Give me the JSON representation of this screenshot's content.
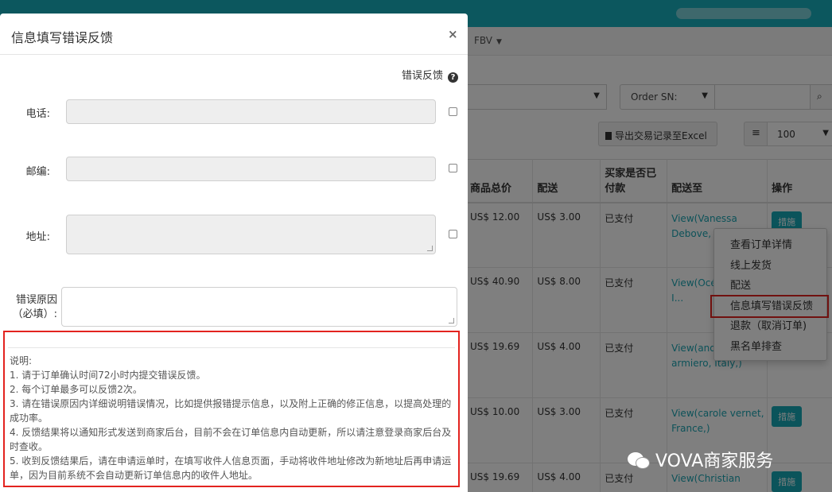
{
  "background": {
    "nav_item": "FBV",
    "order_sn_label": "Order SN:",
    "export_button": "导出交易记录至Excel",
    "page_size": "100",
    "table": {
      "headers": [
        "商品总价",
        "配送",
        "买家是否已付款",
        "配送至",
        "操作"
      ],
      "rows": [
        {
          "total": "US$ 12.00",
          "shipping": "US$ 3.00",
          "paid": "已支付",
          "ship_to": "View(Vanessa Debove, F...",
          "action": "措施"
        },
        {
          "total": "US$ 40.90",
          "shipping": "US$ 8.00",
          "paid": "已支付",
          "ship_to": "View(Océ... Lagana, I...",
          "action": ""
        },
        {
          "total": "US$ 19.69",
          "shipping": "US$ 4.00",
          "paid": "已支付",
          "ship_to": "View(andr... armiero, Italy,)",
          "action": ""
        },
        {
          "total": "US$ 10.00",
          "shipping": "US$ 3.00",
          "paid": "已支付",
          "ship_to": "View(carole vernet, France,)",
          "action": "措施"
        },
        {
          "total": "US$ 19.69",
          "shipping": "US$ 4.00",
          "paid": "已支付",
          "ship_to": "View(Christian",
          "action": "措施"
        }
      ]
    },
    "context_menu": [
      "查看订单详情",
      "线上发货",
      "配送",
      "信息填写错误反馈",
      "退款（取消订单)",
      "黑名单排查"
    ]
  },
  "modal": {
    "title": "信息填写错误反馈",
    "close": "×",
    "error_feedback_header": "错误反馈",
    "help_icon": "?",
    "fields": {
      "phone_label": "电话:",
      "zip_label": "邮编:",
      "address_label": "地址:",
      "reason_label_1": "错误原因",
      "reason_label_2": "（必填）:"
    },
    "notes": {
      "title": "说明:",
      "line1": "1. 请于订单确认时间72小时内提交错误反馈。",
      "line2": "2. 每个订单最多可以反馈2次。",
      "line3": "3. 请在错误原因内详细说明错误情况，比如提供报错提示信息，以及附上正确的修正信息，以提高处理的成功率。",
      "line4": "4. 反馈结果将以通知形式发送到商家后台，目前不会在订单信息内自动更新，所以请注意登录商家后台及时查收。",
      "line5": "5. 收到反馈结果后，请在申请运单时，在填写收件人信息页面，手动将收件地址修改为新地址后再申请运单，因为目前系统不会自动更新订单信息内的收件人地址。"
    }
  },
  "watermark": "VOVA商家服务",
  "colors": {
    "teal": "#18aebc",
    "highlight_red": "#e3231f",
    "link": "#1aa4b2"
  }
}
